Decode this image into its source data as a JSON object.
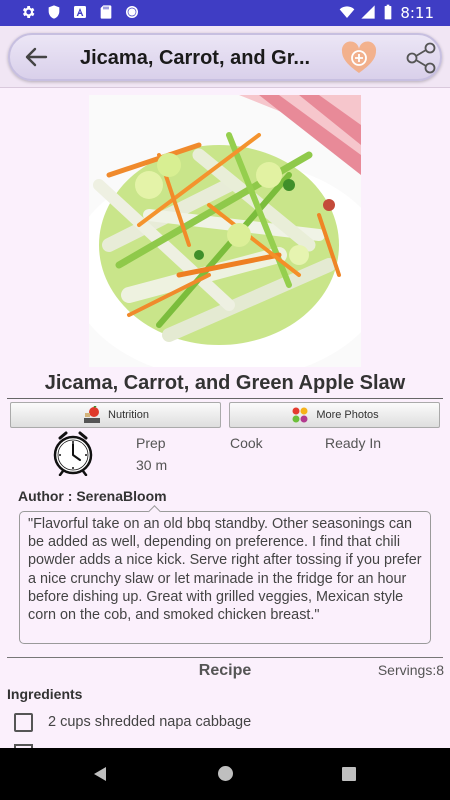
{
  "status_bar": {
    "time": "8:11",
    "left_icons": [
      "gear-icon",
      "shield-icon",
      "font-a-icon",
      "sd-card-icon",
      "circle-icon"
    ],
    "right_icons": [
      "wifi-icon",
      "signal-icon",
      "battery-icon"
    ],
    "background": "#3f3dc4"
  },
  "app_bar": {
    "title": "Jicama, Carrot, and Gr...",
    "back_icon": "arrow-left-icon",
    "favorite_icon": "heart-plus-icon",
    "share_icon": "share-icon"
  },
  "recipe": {
    "title": "Jicama, Carrot, and Green Apple Slaw",
    "image_subject": "slaw salad photo",
    "tabs": [
      {
        "label": "Nutrition",
        "icon": "apple-scale-icon"
      },
      {
        "label": "More Photos",
        "icon": "fruit-icon"
      }
    ],
    "times": {
      "icon": "clock-icon",
      "prep_label": "Prep",
      "prep_value": "30 m",
      "cook_label": "Cook",
      "cook_value": "",
      "ready_label": "Ready In",
      "ready_value": ""
    },
    "author": "Author : SerenaBloom",
    "description": "\"Flavorful take on an old bbq standby. Other seasonings can be added as well, depending on preference. I find that chili powder adds a nice kick. Serve right after tossing if you prefer a nice crunchy slaw or let marinade in the fridge for an hour before dishing up. Great with grilled veggies, Mexican style corn on the cob, and smoked chicken breast.\"",
    "section_header": "Recipe",
    "servings": "Servings:8",
    "ingredients_header": "Ingredients",
    "ingredients": [
      {
        "text": "2 cups shredded napa cabbage",
        "checked": false
      }
    ]
  },
  "nav_bar": {
    "icons": [
      "nav-back-icon",
      "nav-home-icon",
      "nav-recents-icon"
    ]
  },
  "colors": {
    "page_background": "#fbf0fc",
    "accent_heart": "#f5a97b"
  }
}
